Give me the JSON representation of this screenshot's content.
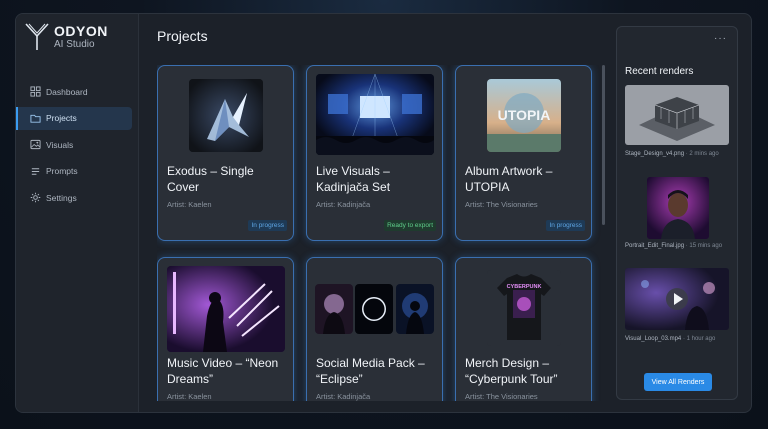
{
  "brand": {
    "name": "ODYON",
    "subtitle": "AI Studio",
    "logo_icon": "y-logo-icon"
  },
  "sidebar": {
    "items": [
      {
        "label": "Dashboard",
        "icon": "dashboard-icon",
        "active": false
      },
      {
        "label": "Projects",
        "icon": "folder-icon",
        "active": true
      },
      {
        "label": "Visuals",
        "icon": "image-icon",
        "active": false
      },
      {
        "label": "Prompts",
        "icon": "list-icon",
        "active": false
      },
      {
        "label": "Settings",
        "icon": "gear-icon",
        "active": false
      }
    ]
  },
  "main": {
    "title": "Projects",
    "projects": [
      {
        "title": "Exodus – Single Cover",
        "artist": "Artist: Kaelen",
        "status": "In progress",
        "status_color": "#5fa7e6"
      },
      {
        "title": "Live Visuals – Kadinjača Set",
        "artist": "Artist: Kadinjača",
        "status": "Ready to export",
        "status_color": "#5fcf8a"
      },
      {
        "title": "Album Artwork – UTOPIA",
        "artist": "Artist: The Visionaries",
        "status": "In progress",
        "status_color": "#5fa7e6",
        "thumb_text": "UTOPIA"
      },
      {
        "title": "Music Video – “Neon Dreams”",
        "artist": "Artist: Kaelen"
      },
      {
        "title": "Social Media Pack – “Eclipse”",
        "artist": "Artist: Kadinjača"
      },
      {
        "title": "Merch Design – “Cyberpunk Tour”",
        "artist": "Artist: The Visionaries",
        "thumb_text": "CYBERPUNK"
      }
    ]
  },
  "recent": {
    "more_label": "···",
    "title": "Recent renders",
    "items": [
      {
        "file": "Stage_Design_v4.png",
        "time": "· 2 mins ago"
      },
      {
        "file": "Portrait_Edit_Final.jpg",
        "time": "· 15 mins ago"
      },
      {
        "file": "Visual_Loop_03.mp4",
        "time": "· 1 hour ago"
      }
    ],
    "view_all_label": "View All Renders"
  },
  "colors": {
    "accent": "#2a8ae6",
    "card_border": "#3a6fb0",
    "background": "#1c2129"
  }
}
